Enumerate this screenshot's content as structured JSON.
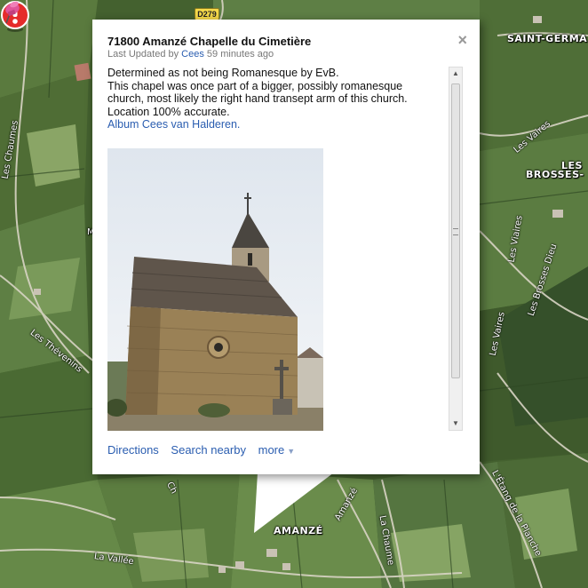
{
  "map": {
    "route_shield": "D279",
    "places": {
      "saint_germain": "SAINT-GERMA",
      "les_brosses_line1": "LES",
      "les_brosses_line2": "BROSSES-",
      "amanze": "AMANZÉ",
      "m_partial": "M"
    },
    "roads": {
      "les_chaumes": "Les Chaumes",
      "les_thevenins": "Les Thévenins",
      "les_vaires_1": "Les Vaires",
      "les_viaires": "Les Viaires",
      "les_brosses_dieu": "Les Brosses Dieu",
      "les_vaires_2": "Les Vaires",
      "la_vallee": "La Vallée",
      "la_chaume": "La Chaume",
      "amanze_road": "Amanzé",
      "etang": "L'Étang de la Planche",
      "small_road": "Ch"
    }
  },
  "info_window": {
    "title": "71800 Amanzé Chapelle du Cimetière",
    "updated_prefix": "Last Updated by ",
    "updated_author": "Cees",
    "updated_suffix": " 59 minutes ago",
    "description_lines": [
      "Determined as not being Romanesque by EvB.",
      "This chapel was once part of a bigger, possibly romanesque",
      "church, most likely the right hand transept arm of this church.",
      "Location 100% accurate."
    ],
    "album_link": "Album Cees van Halderen.",
    "close_label": "×",
    "actions": {
      "directions": "Directions",
      "search_nearby": "Search nearby",
      "more": "more"
    }
  },
  "colors": {
    "link": "#2a5db0",
    "marker": "#e52b2b",
    "pin": "#e0569a"
  }
}
